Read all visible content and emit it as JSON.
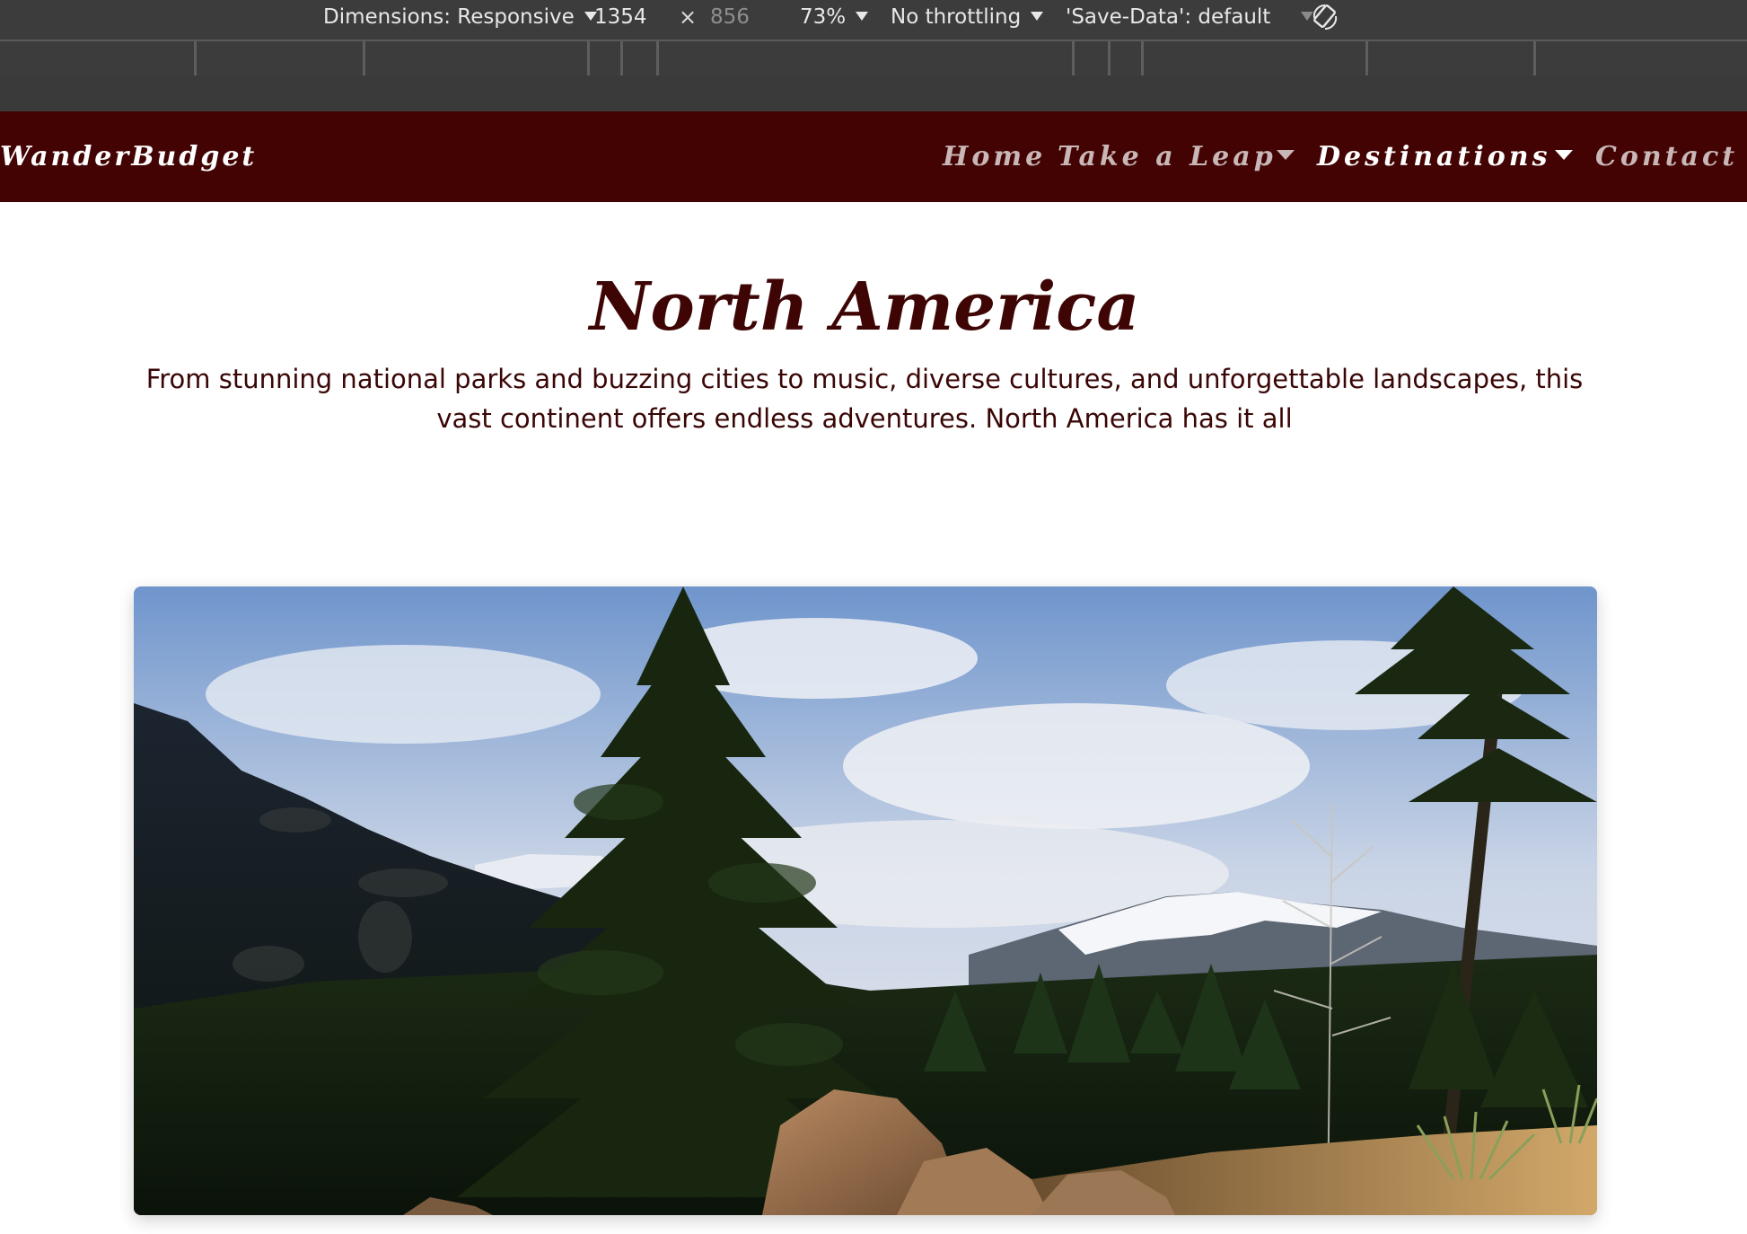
{
  "devtools": {
    "dimensions_label": "Dimensions: Responsive",
    "width_value": "1354",
    "times_symbol": "×",
    "height_value": "856",
    "zoom": "73%",
    "throttling": "No throttling",
    "save_data": "'Save-Data': default",
    "rotate_icon": "rotate-icon"
  },
  "navbar": {
    "brand": "WanderBudget",
    "links": [
      {
        "label": "Home"
      },
      {
        "label": "Take a Leap"
      },
      {
        "label": "Destinations"
      },
      {
        "label": "Contact"
      }
    ],
    "background_color": "#430303"
  },
  "hero": {
    "title": "North America",
    "description": "From stunning national parks and buzzing cities to music, diverse cultures, and unforgettable landscapes, this vast continent offers endless adventures. North America has it all"
  },
  "colors": {
    "title": "#3f0505",
    "text": "#3a0606",
    "nav_inactive": "#c9b7b7"
  }
}
